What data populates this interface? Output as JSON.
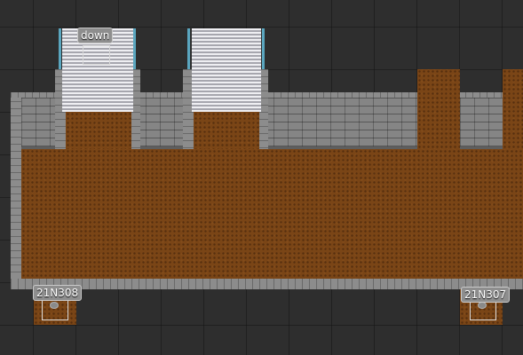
{
  "labels": {
    "stairs": "down",
    "door_left": "21N308",
    "door_right": "21N307"
  },
  "colors": {
    "background": "#2e2e2e",
    "dirt": "#7a4516",
    "stone": "#858585",
    "stairs": "#c8c8cf",
    "stair_rail": "#5aa6bf",
    "label_bg": "#8e8e8e"
  }
}
